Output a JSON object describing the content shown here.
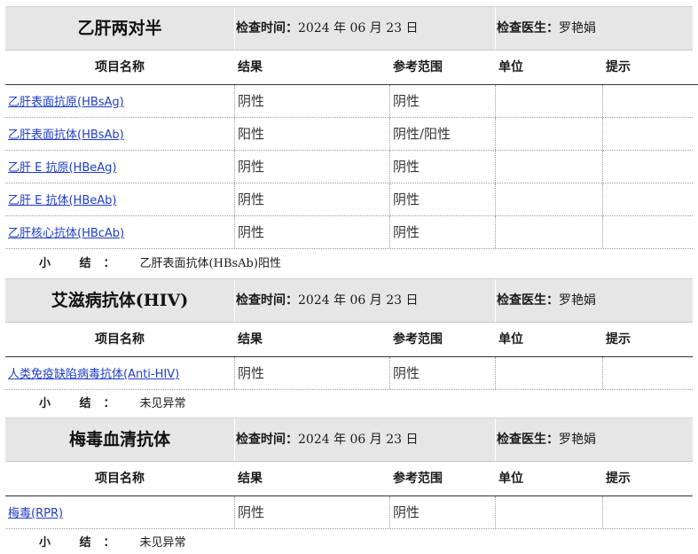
{
  "column_headers": {
    "name": "项目名称",
    "result": "结果",
    "reference": "参考范围",
    "unit": "单位",
    "hint": "提示"
  },
  "labels": {
    "check_time": "检查时间：",
    "doctor": "检查医生：",
    "summary": "小 结："
  },
  "sections": [
    {
      "title": "乙肝两对半",
      "check_time": "2024 年 06 月 23 日",
      "doctor": "罗艳娟",
      "rows": [
        {
          "name": "乙肝表面抗原(HBsAg)",
          "result": "阴性",
          "reference": "阴性",
          "unit": "",
          "hint": ""
        },
        {
          "name": "乙肝表面抗体(HBsAb)",
          "result": "阳性",
          "reference": "阴性/阳性",
          "unit": "",
          "hint": ""
        },
        {
          "name": "乙肝 E 抗原(HBeAg)",
          "result": "阴性",
          "reference": "阴性",
          "unit": "",
          "hint": ""
        },
        {
          "name": "乙肝 E 抗体(HBeAb)",
          "result": "阴性",
          "reference": "阴性",
          "unit": "",
          "hint": ""
        },
        {
          "name": "乙肝核心抗体(HBcAb)",
          "result": "阴性",
          "reference": "阴性",
          "unit": "",
          "hint": ""
        }
      ],
      "summary": "乙肝表面抗体(HBsAb)阳性"
    },
    {
      "title": "艾滋病抗体(HIV)",
      "check_time": "2024 年 06 月 23 日",
      "doctor": "罗艳娟",
      "rows": [
        {
          "name": "人类免疫缺陷病毒抗体(Anti-HIV)",
          "result": "阴性",
          "reference": "阴性",
          "unit": "",
          "hint": ""
        }
      ],
      "summary": "未见异常"
    },
    {
      "title": "梅毒血清抗体",
      "check_time": "2024 年 06 月 23 日",
      "doctor": "罗艳娟",
      "rows": [
        {
          "name": "梅毒(RPR)",
          "result": "阴性",
          "reference": "阴性",
          "unit": "",
          "hint": ""
        }
      ],
      "summary": "未见异常"
    }
  ]
}
